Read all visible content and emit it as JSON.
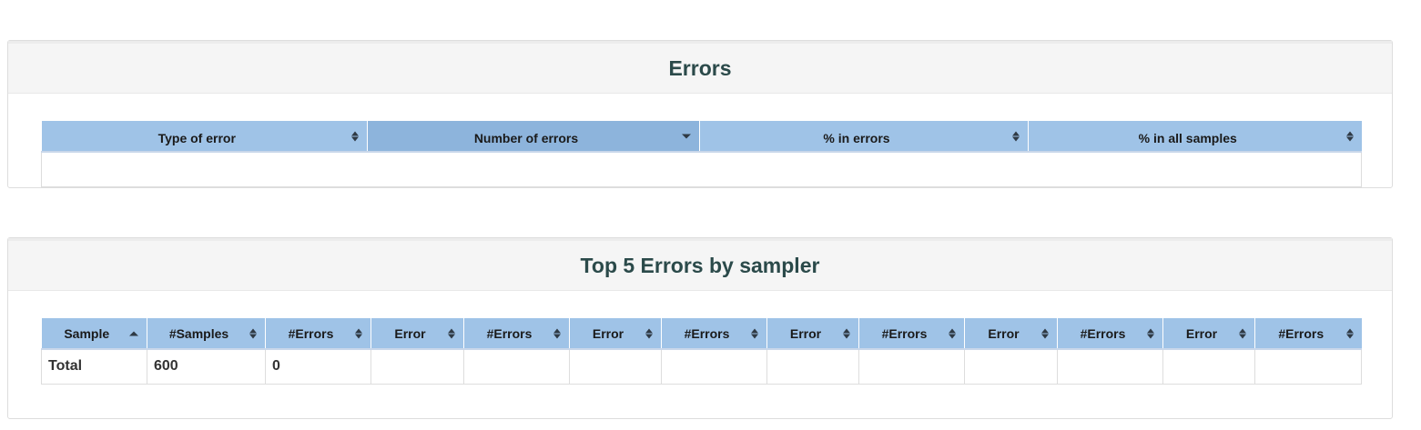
{
  "errors_panel": {
    "title": "Errors",
    "columns": [
      {
        "label": "Type of error",
        "sort": "both"
      },
      {
        "label": "Number of errors",
        "sort": "desc"
      },
      {
        "label": "% in errors",
        "sort": "both"
      },
      {
        "label": "% in all samples",
        "sort": "both"
      }
    ],
    "rows": []
  },
  "top5_panel": {
    "title": "Top 5 Errors by sampler",
    "columns": [
      {
        "label": "Sample",
        "sort": "asc"
      },
      {
        "label": "#Samples",
        "sort": "both"
      },
      {
        "label": "#Errors",
        "sort": "both"
      },
      {
        "label": "Error",
        "sort": "both"
      },
      {
        "label": "#Errors",
        "sort": "both"
      },
      {
        "label": "Error",
        "sort": "both"
      },
      {
        "label": "#Errors",
        "sort": "both"
      },
      {
        "label": "Error",
        "sort": "both"
      },
      {
        "label": "#Errors",
        "sort": "both"
      },
      {
        "label": "Error",
        "sort": "both"
      },
      {
        "label": "#Errors",
        "sort": "both"
      },
      {
        "label": "Error",
        "sort": "both"
      },
      {
        "label": "#Errors",
        "sort": "both"
      }
    ],
    "rows": [
      {
        "cells": [
          "Total",
          "600",
          "0",
          "",
          "",
          "",
          "",
          "",
          "",
          "",
          "",
          "",
          ""
        ]
      }
    ]
  },
  "colors": {
    "header_bg": "#9fc3e7",
    "sorted_header_bg": "#8db4dc",
    "title_color": "#2b4a4a",
    "panel_heading_bg": "#f5f5f5"
  }
}
